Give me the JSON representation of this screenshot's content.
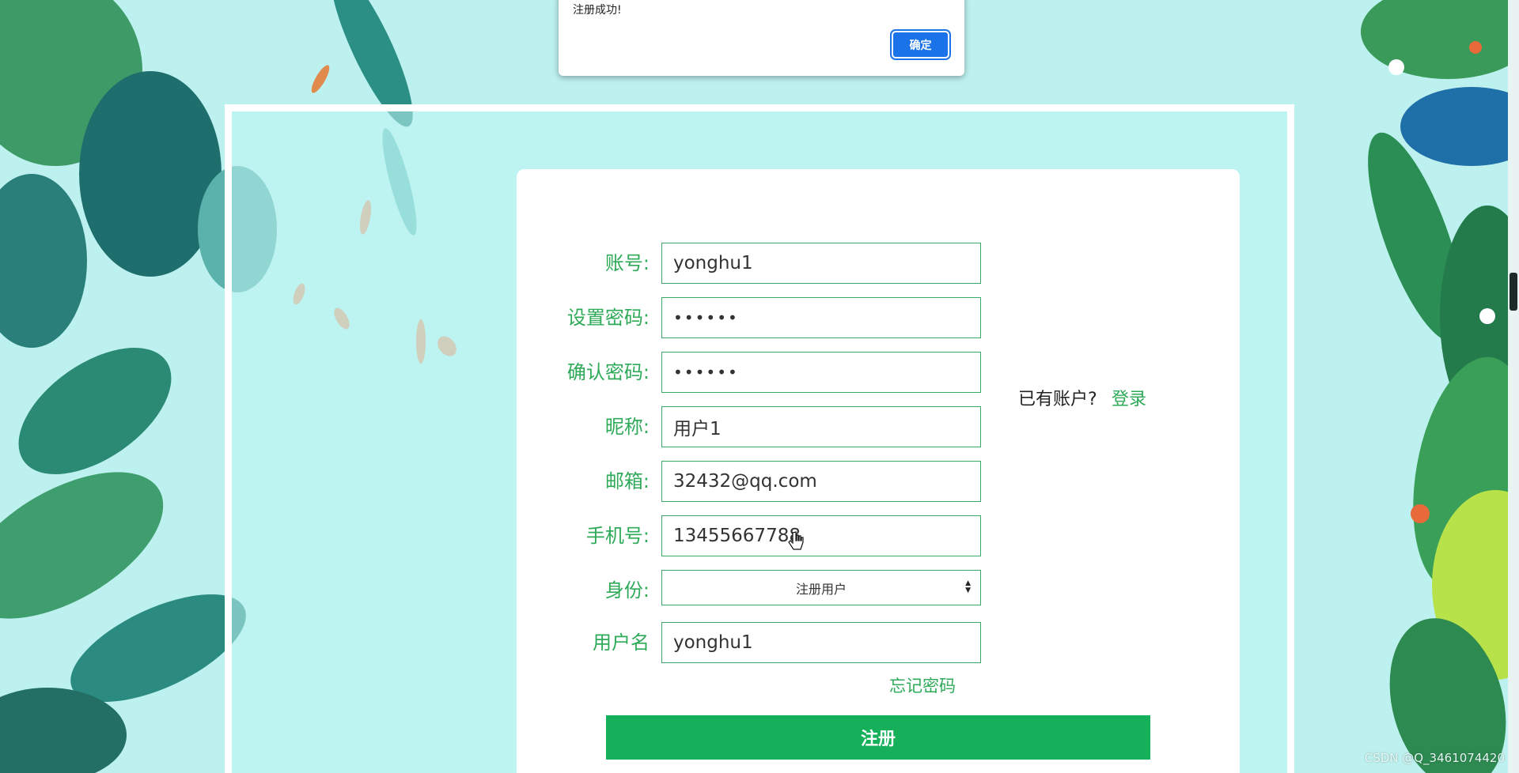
{
  "dialog": {
    "message": "注册成功!",
    "ok_label": "确定"
  },
  "form": {
    "fields": [
      {
        "label": "账号:",
        "value": "yonghu1"
      },
      {
        "label": "设置密码:",
        "value": "••••••"
      },
      {
        "label": "确认密码:",
        "value": "••••••"
      },
      {
        "label": "昵称:",
        "value": "用户1"
      },
      {
        "label": "邮箱:",
        "value": "32432@qq.com"
      },
      {
        "label": "手机号:",
        "value": "13455667788"
      },
      {
        "label": "身份:",
        "value": "注册用户"
      },
      {
        "label": "用户名",
        "value": "yonghu1"
      }
    ],
    "have_account": "已有账户?",
    "login_label": "登录",
    "forgot_label": "忘记密码",
    "submit_label": "注册"
  },
  "watermark": "CSDN @Q_3461074420",
  "colors": {
    "accent": "#2eaa58",
    "button": "#17b05a",
    "dialog_button": "#1a73e8",
    "background": "#bdf1ef"
  }
}
